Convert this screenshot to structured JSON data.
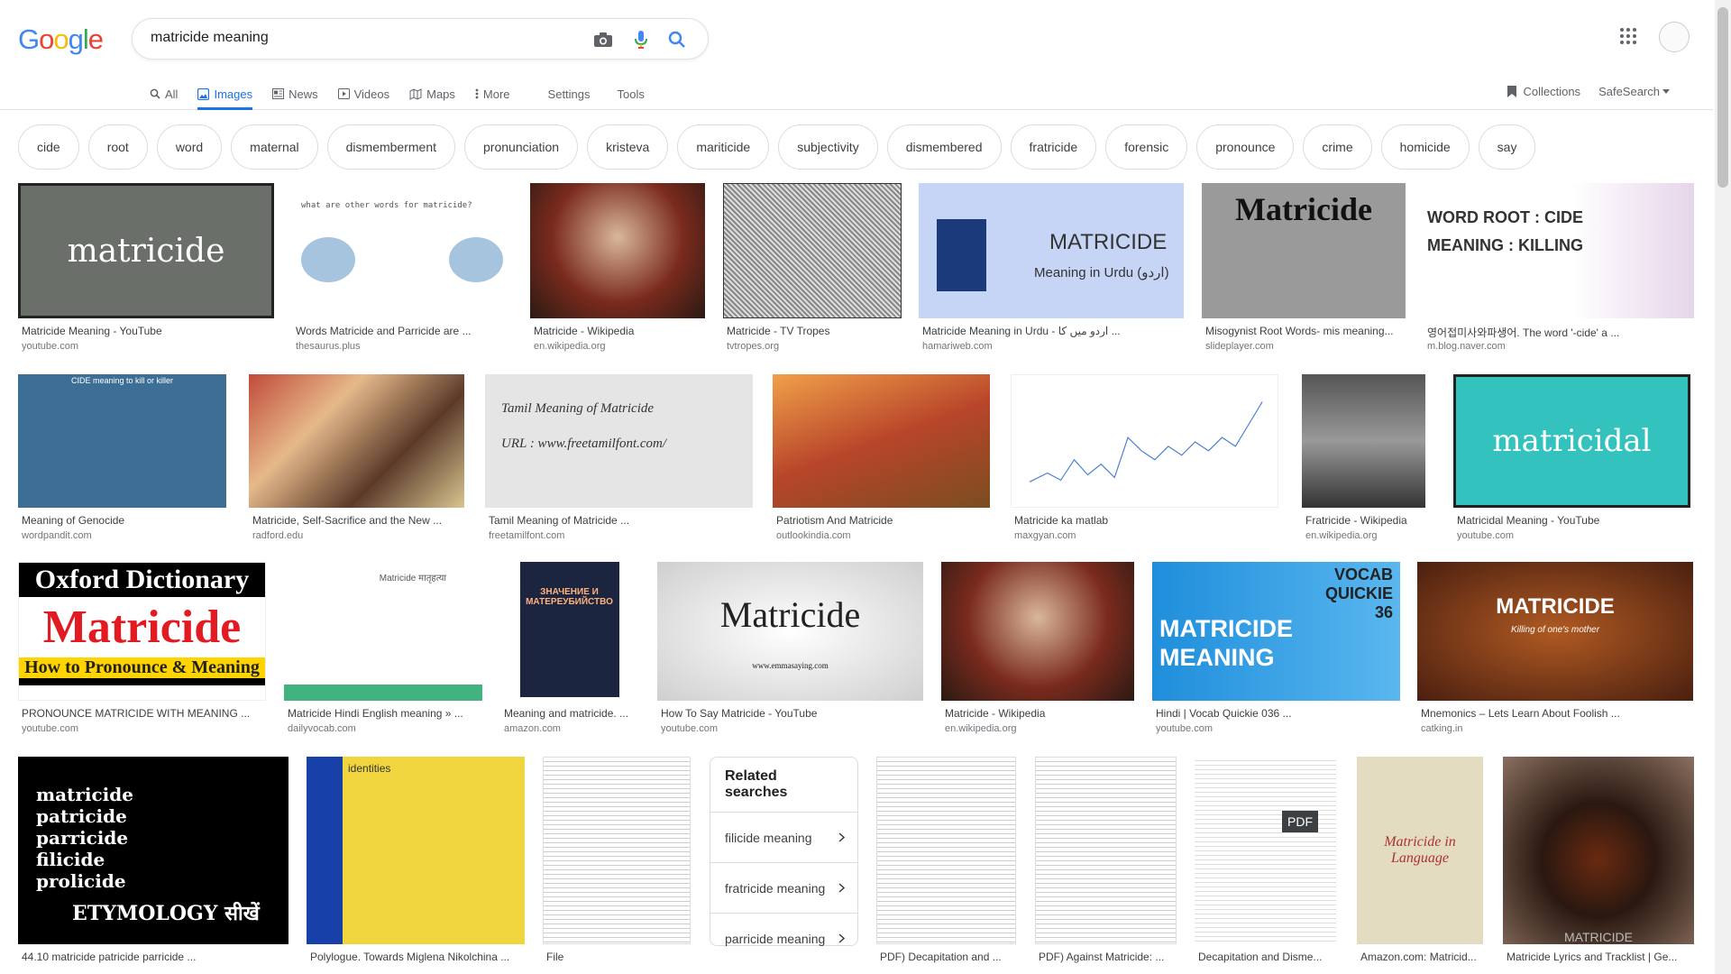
{
  "search": {
    "query": "matricide meaning"
  },
  "tabs": [
    {
      "label": "All",
      "icon": "search-icon"
    },
    {
      "label": "Images",
      "icon": "image-icon"
    },
    {
      "label": "News",
      "icon": "news-icon"
    },
    {
      "label": "Videos",
      "icon": "video-icon"
    },
    {
      "label": "Maps",
      "icon": "map-icon"
    },
    {
      "label": "More",
      "icon": "more-icon"
    }
  ],
  "settings_label": "Settings",
  "tools_label": "Tools",
  "collections_label": "Collections",
  "safesearch_label": "SafeSearch",
  "chips": [
    "cide",
    "root",
    "word",
    "maternal",
    "dismemberment",
    "pronunciation",
    "kristeva",
    "mariticide",
    "subjectivity",
    "dismembered",
    "fratricide",
    "forensic",
    "pronounce",
    "crime",
    "homicide",
    "say"
  ],
  "results": [
    {
      "caption": "Matricide Meaning - YouTube",
      "source": "youtube.com",
      "thumb_text": "matricide"
    },
    {
      "caption": "Words Matricide and Parricide are ...",
      "source": "thesaurus.plus",
      "thumb_text": "what are other words for matricide?"
    },
    {
      "caption": "Matricide - Wikipedia",
      "source": "en.wikipedia.org",
      "thumb_text": ""
    },
    {
      "caption": "Matricide - TV Tropes",
      "source": "tvtropes.org",
      "thumb_text": ""
    },
    {
      "caption": "Matricide Meaning in Urdu - اردو میں کا ...",
      "source": "hamariweb.com",
      "thumb_text": "MATRICIDE",
      "thumb_sub": "Meaning in Urdu (اردو)"
    },
    {
      "caption": "Misogynist Root Words- mis meaning...",
      "source": "slideplayer.com",
      "thumb_text": "Matricide"
    },
    {
      "caption": "영어접미사와파생어. The word '-cide' a ...",
      "source": "m.blog.naver.com",
      "thumb_text": "WORD ROOT : CIDE",
      "thumb_sub": "MEANING : KILLING"
    },
    {
      "caption": "Meaning of Genocide",
      "source": "wordpandit.com",
      "thumb_text": "CIDE meaning to kill or killer"
    },
    {
      "caption": "Matricide, Self-Sacrifice and the New ...",
      "source": "radford.edu",
      "thumb_text": ""
    },
    {
      "caption": "Tamil Meaning of Matricide ...",
      "source": "freetamilfont.com",
      "thumb_text": "Tamil Meaning of Matricide",
      "thumb_sub": "URL : www.freetamilfont.com/"
    },
    {
      "caption": "Patriotism And Matricide",
      "source": "outlookindia.com",
      "thumb_text": ""
    },
    {
      "caption": "Matricide ka matlab",
      "source": "maxgyan.com",
      "thumb_text": ""
    },
    {
      "caption": "Fratricide - Wikipedia",
      "source": "en.wikipedia.org",
      "thumb_text": ""
    },
    {
      "caption": "Matricidal Meaning - YouTube",
      "source": "youtube.com",
      "thumb_text": "matricidal"
    },
    {
      "caption": "PRONOUNCE MATRICIDE WITH MEANING ...",
      "source": "youtube.com",
      "thumb_text": "Oxford Dictionary",
      "thumb_sub": "Matricide",
      "thumb_foot": "How to Pronounce & Meaning"
    },
    {
      "caption": "Matricide Hindi English meaning » ...",
      "source": "dailyvocab.com",
      "thumb_text": "Matricide मातृहत्या"
    },
    {
      "caption": "Meaning and matricide. ...",
      "source": "amazon.com",
      "thumb_text": "ЗНАЧЕНИЕ И МАТЕРЕУБИЙСТВО"
    },
    {
      "caption": "How To Say Matricide - YouTube",
      "source": "youtube.com",
      "thumb_text": "Matricide",
      "thumb_sub": "www.emmasaying.com"
    },
    {
      "caption": "Matricide - Wikipedia",
      "source": "en.wikipedia.org",
      "thumb_text": ""
    },
    {
      "caption": "Hindi | Vocab Quickie 036 ...",
      "source": "youtube.com",
      "thumb_text": "MATRICIDE MEANING",
      "thumb_sub": "VOCAB QUICKIE 36"
    },
    {
      "caption": "Mnemonics – Lets Learn About Foolish ...",
      "source": "catking.in",
      "thumb_text": "MATRICIDE",
      "thumb_sub": "Killing of one's mother"
    },
    {
      "caption": "44.10 matricide patricide parricide ...",
      "source": "",
      "thumb_text": "matricide patricide parricide filicide prolicide",
      "thumb_foot": "ETYMOLOGY सीखें"
    },
    {
      "caption": "Polylogue. Towards Miglena Nikolchina ...",
      "source": "",
      "thumb_text": "identities"
    },
    {
      "caption": "File",
      "source": "",
      "thumb_text": ""
    },
    {
      "caption": "PDF) Decapitation and ...",
      "source": "",
      "thumb_text": ""
    },
    {
      "caption": "PDF) Against Matricide: ...",
      "source": "",
      "thumb_text": ""
    },
    {
      "caption": "Decapitation and Disme...",
      "source": "",
      "thumb_text": "PDF"
    },
    {
      "caption": "Amazon.com: Matricid...",
      "source": "",
      "thumb_text": "Matricide in Language"
    },
    {
      "caption": "Matricide Lyrics and Tracklist | Ge...",
      "source": "",
      "thumb_text": "MATRICIDE"
    }
  ],
  "related": {
    "title": "Related searches",
    "items": [
      "filicide meaning",
      "fratricide meaning",
      "parricide meaning"
    ]
  }
}
